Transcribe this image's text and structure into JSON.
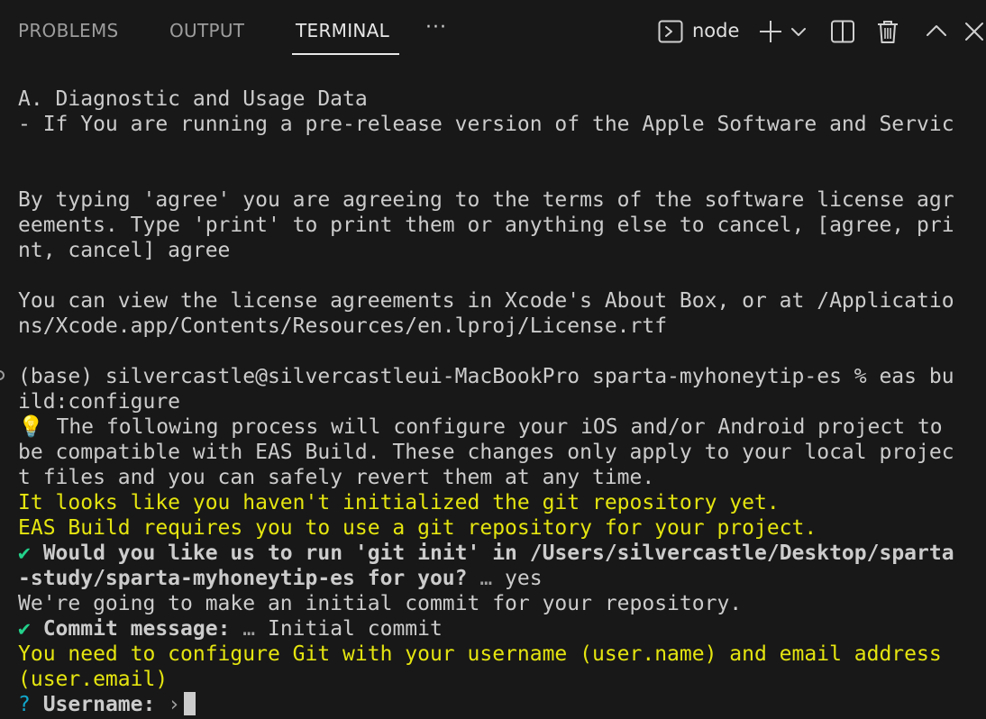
{
  "panel": {
    "tabs": [
      {
        "label": "PROBLEMS",
        "active": false
      },
      {
        "label": "OUTPUT",
        "active": false
      },
      {
        "label": "TERMINAL",
        "active": true
      }
    ],
    "more_label": "···",
    "terminal_name": "node",
    "icons": [
      "terminal-icon",
      "plus-icon",
      "chevron-down-icon",
      "split-icon",
      "trash-icon",
      "chevron-up-icon",
      "close-icon"
    ],
    "colors": {
      "background": "#181818",
      "yellow": "#e5e510",
      "green": "#23d18b",
      "cyan": "#11a8cd",
      "text": "#cccccc"
    }
  },
  "terminal": {
    "l1": "A. Diagnostic and Usage Data",
    "l2": "- If You are running a pre-release version of the Apple Software and Servic",
    "l3": "By typing 'agree' you are agreeing to the terms of the software license agr",
    "l4": "eements. Type 'print' to print them or anything else to cancel, [agree, pri",
    "l5": "nt, cancel] agree",
    "l6": "You can view the license agreements in Xcode's About Box, or at /Applicatio",
    "l7": "ns/Xcode.app/Contents/Resources/en.lproj/License.rtf",
    "l8": "(base) silvercastle@silvercastleui-MacBookPro sparta-myhoneytip-es % eas bu",
    "l9": "ild:configure",
    "l10_icon": "💡",
    "l10": " The following process will configure your iOS and/or Android project to",
    "l11": "be compatible with EAS Build. These changes only apply to your local projec",
    "l12": "t files and you can safely revert them at any time.",
    "l13": "It looks like you haven't initialized the git repository yet.",
    "l14": "EAS Build requires you to use a git repository for your project.",
    "l15_check": "✔",
    "l15": " Would you like us to run 'git init' in /Users/silvercastle/Desktop/sparta",
    "l16_bold": "-study/sparta-myhoneytip-es for you?",
    "l16_ellipsis": " …",
    "l16_answer": " yes",
    "l17": "We're going to make an initial commit for your repository.",
    "l18_check": "✔",
    "l18_bold": " Commit message:",
    "l18_ellipsis": " …",
    "l18_answer": " Initial commit",
    "l19": "You need to configure Git with your username (user.name) and email address",
    "l20": "(user.email)",
    "l21_q": "?",
    "l21_bold": " Username:",
    "l21_arrow": " ›"
  }
}
